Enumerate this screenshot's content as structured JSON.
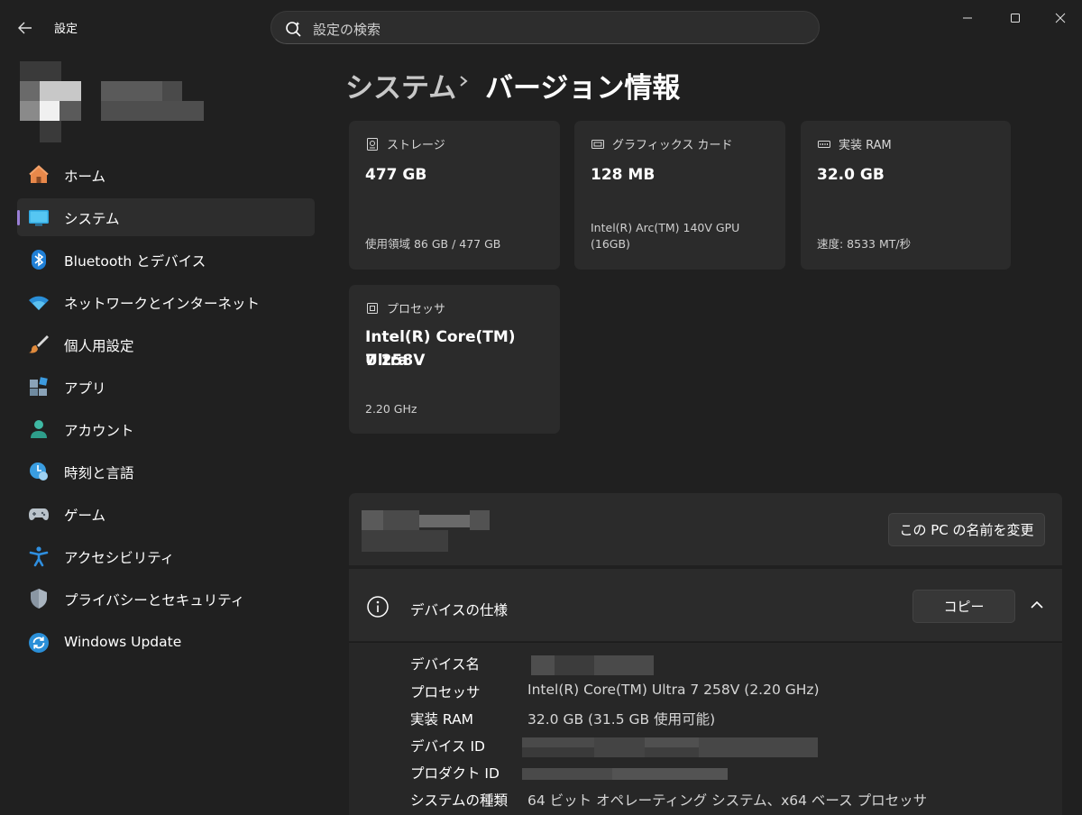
{
  "titlebar": {
    "app_title": "設定",
    "search_placeholder": "設定の検索"
  },
  "sidebar": {
    "items": [
      {
        "label": "ホーム",
        "icon": "home-icon"
      },
      {
        "label": "システム",
        "icon": "system-icon",
        "selected": true
      },
      {
        "label": "Bluetooth とデバイス",
        "icon": "bluetooth-icon"
      },
      {
        "label": "ネットワークとインターネット",
        "icon": "wifi-icon"
      },
      {
        "label": "個人用設定",
        "icon": "brush-icon"
      },
      {
        "label": "アプリ",
        "icon": "apps-icon"
      },
      {
        "label": "アカウント",
        "icon": "account-icon"
      },
      {
        "label": "時刻と言語",
        "icon": "time-language-icon"
      },
      {
        "label": "ゲーム",
        "icon": "gamepad-icon"
      },
      {
        "label": "アクセシビリティ",
        "icon": "accessibility-icon"
      },
      {
        "label": "プライバシーとセキュリティ",
        "icon": "shield-icon"
      },
      {
        "label": "Windows Update",
        "icon": "windows-update-icon"
      }
    ]
  },
  "breadcrumb": {
    "parent": "システム",
    "current": "バージョン情報"
  },
  "cards": {
    "storage": {
      "label": "ストレージ",
      "value": "477 GB",
      "detail": "使用領域 86 GB / 477 GB"
    },
    "graphics": {
      "label": "グラフィックス カード",
      "value": "128 MB",
      "detail_line1": "Intel(R) Arc(TM) 140V GPU",
      "detail_line2": "(16GB)"
    },
    "ram": {
      "label": "実装 RAM",
      "value": "32.0 GB",
      "detail": "速度: 8533 MT/秒"
    },
    "processor": {
      "label": "プロセッサ",
      "value_line1": "Intel(R) Core(TM) Ultra",
      "value_line2": "7 258V",
      "detail": "2.20 GHz"
    }
  },
  "pc_name": {
    "rename_button": "この PC の名前を変更"
  },
  "device_specs": {
    "title": "デバイスの仕様",
    "copy_button": "コピー",
    "rows": [
      {
        "key": "デバイス名",
        "value": ""
      },
      {
        "key": "プロセッサ",
        "value": "Intel(R) Core(TM) Ultra 7 258V (2.20 GHz)"
      },
      {
        "key": "実装 RAM",
        "value": "32.0 GB (31.5 GB 使用可能)"
      },
      {
        "key": "デバイス ID",
        "value": ""
      },
      {
        "key": "プロダクト ID",
        "value": ""
      },
      {
        "key": "システムの種類",
        "value": "64 ビット オペレーティング システム、x64 ベース プロセッサ"
      }
    ]
  },
  "colors": {
    "background": "#202020",
    "card": "#2b2b2b",
    "accent_indicator": "#9a7fd6"
  }
}
